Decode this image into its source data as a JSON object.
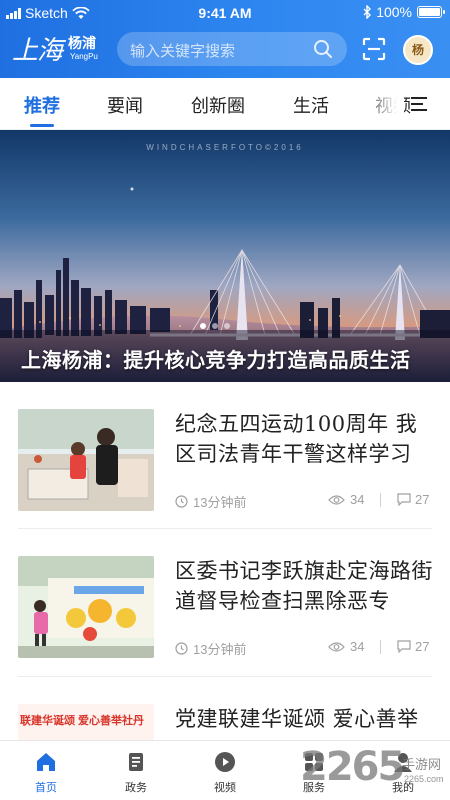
{
  "status_bar": {
    "carrier": "Sketch",
    "time": "9:41 AM",
    "battery": "100%",
    "battery_level": 1.0
  },
  "header": {
    "logo_cn_main": "上海",
    "logo_cn_sub": "杨浦",
    "logo_en": "YangPu",
    "search_placeholder": "输入关键字搜索",
    "avatar_text": "杨"
  },
  "tabs": [
    {
      "label": "推荐",
      "active": true
    },
    {
      "label": "要闻",
      "active": false
    },
    {
      "label": "创新圈",
      "active": false
    },
    {
      "label": "生活",
      "active": false
    },
    {
      "label": "视频",
      "active": false
    }
  ],
  "hero": {
    "watermark": "WINDCHASERFOTO©2016",
    "title": "上海杨浦：提升核心竞争力打造高品质生活",
    "slide_count": 3,
    "active_slide": 1
  },
  "news": [
    {
      "title": "纪念五四运动100周年 我区司法青年干警这样学习",
      "time": "13分钟前",
      "views": "34",
      "comments": "27",
      "thumb": "classroom-photo"
    },
    {
      "title": "区委书记李跃旗赴定海路街道督导检查扫黑除恶专",
      "time": "13分钟前",
      "views": "34",
      "comments": "27",
      "thumb": "mural-photo"
    },
    {
      "title": "党建联建华诞颂 爱心善举",
      "thumb": "banner-photo",
      "thumb_text": "联建华诞颂 爱心善举社丹"
    }
  ],
  "bottom_nav": [
    {
      "label": "首页",
      "icon": "home-icon",
      "active": true
    },
    {
      "label": "政务",
      "icon": "document-icon",
      "active": false
    },
    {
      "label": "视频",
      "icon": "play-icon",
      "active": false
    },
    {
      "label": "服务",
      "icon": "grid-icon",
      "active": false
    },
    {
      "label": "我的",
      "icon": "user-icon",
      "active": false
    }
  ],
  "watermark": {
    "number": "2265",
    "site_name": "手游网",
    "url": "2265.com"
  },
  "colors": {
    "brand": "#1f6fe0",
    "tab_active": "#1f6fe0",
    "meta_gray": "#a0a0a0"
  }
}
